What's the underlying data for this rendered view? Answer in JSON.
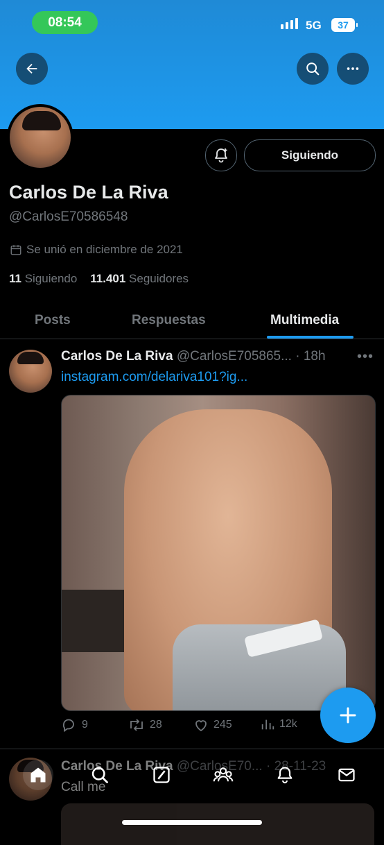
{
  "status_bar": {
    "time": "08:54",
    "network": "5G",
    "battery": "37"
  },
  "header": {
    "back_icon": "back-arrow-icon",
    "search_icon": "search-icon",
    "more_icon": "more-icon",
    "banner_color": "#1d9bf0"
  },
  "profile": {
    "name": "Carlos De La Riva",
    "handle": "@CarlosE70586548",
    "joined": "Se unió en diciembre de 2021",
    "following_count": "11",
    "following_label": "Siguiendo",
    "followers_count": "11.401",
    "followers_label": "Seguidores",
    "follow_button": "Siguiendo"
  },
  "tabs": [
    {
      "label": "Posts",
      "active": false
    },
    {
      "label": "Respuestas",
      "active": false
    },
    {
      "label": "Multimedia",
      "active": true
    }
  ],
  "posts": [
    {
      "name": "Carlos De La Riva",
      "handle": "@CarlosE705865...",
      "time": "· 18h",
      "link": "instagram.com/delariva101?ig...",
      "replies": "9",
      "reposts": "28",
      "likes": "245",
      "views": "12k"
    },
    {
      "name": "Carlos De La Riva",
      "handle": "@CarlosE70...",
      "time": "· 28-11-23",
      "text": "Call me"
    }
  ],
  "bottom_nav": [
    "home-icon",
    "search-icon",
    "grok-icon",
    "communities-icon",
    "notifications-icon",
    "messages-icon"
  ],
  "colors": {
    "accent": "#1d9bf0",
    "muted": "#71767b",
    "text": "#e7e9ea",
    "background": "#000000"
  }
}
